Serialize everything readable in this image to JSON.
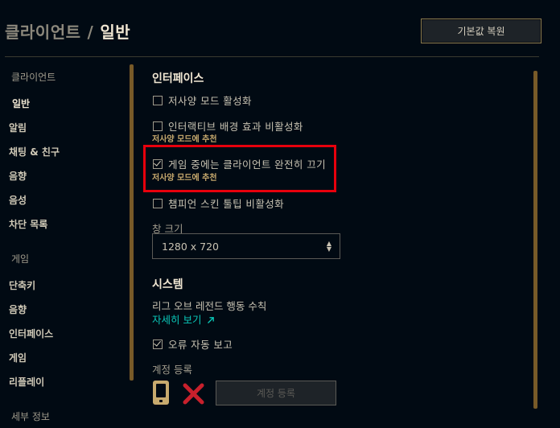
{
  "header": {
    "parent": "클라이언트",
    "separator": "/",
    "current": "일반",
    "reset_button": "기본값 복원"
  },
  "sidebar": {
    "client_category": "클라이언트",
    "client_items": [
      "일반",
      "알림",
      "채팅 & 친구",
      "음향",
      "음성",
      "차단 목록"
    ],
    "game_category": "게임",
    "game_items": [
      "단축키",
      "음향",
      "인터페이스",
      "게임",
      "리플레이"
    ],
    "info_category": "세부 정보"
  },
  "interface": {
    "title": "인터페이스",
    "low_spec_mode": {
      "label": "저사양 모드 활성화",
      "checked": false
    },
    "disable_interactive_bg": {
      "label": "인터랙티브 배경 효과 비활성화",
      "checked": false,
      "note": "저사양 모드에 추천"
    },
    "close_client_in_game": {
      "label": "게임 중에는 클라이언트 완전히 끄기",
      "checked": true,
      "note": "저사양 모드에 추천"
    },
    "disable_champion_skin_tooltip": {
      "label": "챔피언 스킨 툴팁 비활성화",
      "checked": false
    },
    "window_size_label": "창 크기",
    "window_size_value": "1280 x 720"
  },
  "system": {
    "title": "시스템",
    "code_of_conduct": "리그 오브 레전드 행동 수칙",
    "learn_more": "자세히 보기",
    "learn_more_icon": "external-link-icon",
    "error_report": {
      "label": "오류 자동 보고",
      "checked": true
    },
    "account_registration_label": "계정 등록",
    "phone_icon": "phone-icon",
    "status_icon": "red-x-icon",
    "register_button": "계정 등록"
  },
  "colors": {
    "background": "#010a13",
    "gold": "#c8aa6e",
    "link": "#0ac8b9",
    "highlight": "#e8000c",
    "x_red": "#c8202c"
  }
}
